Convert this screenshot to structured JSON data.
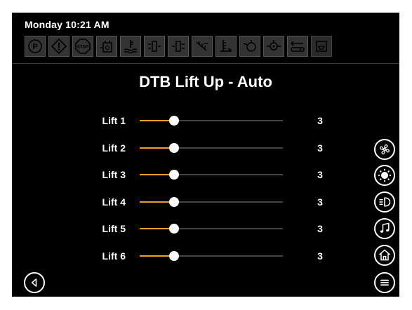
{
  "status": {
    "datetime": "Monday 10:21 AM"
  },
  "indicator_icons": [
    {
      "name": "parking-brake-icon"
    },
    {
      "name": "warning-icon"
    },
    {
      "name": "stop-icon"
    },
    {
      "name": "transmission-fluid-icon"
    },
    {
      "name": "coolant-level-icon"
    },
    {
      "name": "lift-left-icon"
    },
    {
      "name": "lift-right-icon"
    },
    {
      "name": "conveyor-icon"
    },
    {
      "name": "fuel-level-icon"
    },
    {
      "name": "engine-oil-icon"
    },
    {
      "name": "hydraulic-icon"
    },
    {
      "name": "hitch-icon"
    },
    {
      "name": "filter-icon"
    }
  ],
  "page": {
    "title": "DTB Lift Up - Auto"
  },
  "lifts": [
    {
      "label": "Lift 1",
      "value": "3",
      "level": 0.24
    },
    {
      "label": "Lift 2",
      "value": "3",
      "level": 0.24
    },
    {
      "label": "Lift 3",
      "value": "3",
      "level": 0.24
    },
    {
      "label": "Lift 4",
      "value": "3",
      "level": 0.24
    },
    {
      "label": "Lift 5",
      "value": "3",
      "level": 0.24
    },
    {
      "label": "Lift 6",
      "value": "3",
      "level": 0.24
    }
  ],
  "colors": {
    "accent": "#f0a028",
    "background": "#000000",
    "text": "#ffffff"
  },
  "side_buttons": [
    {
      "name": "fan-icon"
    },
    {
      "name": "brightness-icon"
    },
    {
      "name": "headlight-icon"
    },
    {
      "name": "music-icon"
    },
    {
      "name": "home-icon"
    },
    {
      "name": "menu-icon"
    }
  ],
  "nav": {
    "back": "back-icon"
  }
}
